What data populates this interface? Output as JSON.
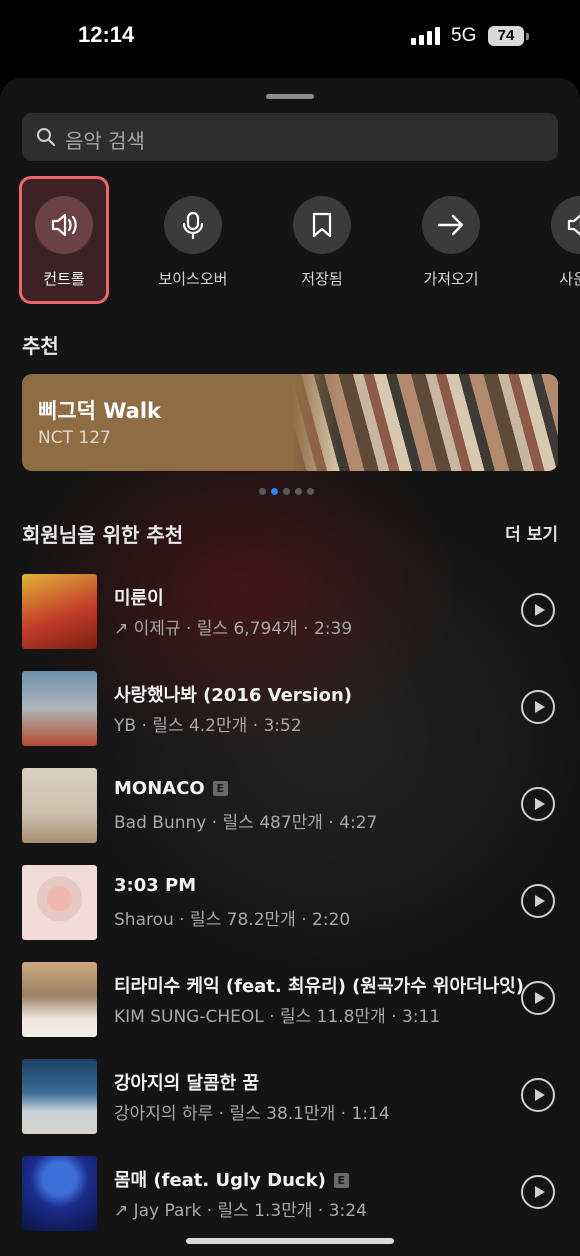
{
  "status": {
    "time": "12:14",
    "network": "5G",
    "battery": "74"
  },
  "search": {
    "placeholder": "음악 검색"
  },
  "actions": [
    {
      "label": "컨트롤",
      "icon": "speaker-icon",
      "active": true
    },
    {
      "label": "보이스오버",
      "icon": "microphone-icon"
    },
    {
      "label": "저장됨",
      "icon": "bookmark-icon"
    },
    {
      "label": "가져오기",
      "icon": "arrow-right-icon"
    },
    {
      "label": "사운드",
      "icon": "speaker-icon"
    }
  ],
  "recommended": {
    "title": "추천",
    "banner": {
      "song": "삐그덕 Walk",
      "artist": "NCT 127"
    },
    "pages": 5,
    "current_page": 2
  },
  "for_you": {
    "title": "회원님을 위한 추천",
    "more": "더 보기",
    "tracks": [
      {
        "title": "미룬이",
        "sub": "↗ 이제규 · 릴스 6,794개 · 2:39",
        "explicit": false
      },
      {
        "title": "사랑했나봐 (2016 Version)",
        "sub": "YB · 릴스 4.2만개 · 3:52",
        "explicit": false
      },
      {
        "title": "MONACO",
        "sub": "Bad Bunny · 릴스 487만개 · 4:27",
        "explicit": true
      },
      {
        "title": "3:03 PM",
        "sub": "Sharou · 릴스 78.2만개 · 2:20",
        "explicit": false
      },
      {
        "title": "티라미수 케익 (feat. 최유리) (원곡가수 위아더나잇)",
        "sub": "KIM SUNG-CHEOL · 릴스 11.8만개 · 3:11",
        "explicit": false
      },
      {
        "title": "강아지의 달콤한 꿈",
        "sub": "강아지의 하루 · 릴스 38.1만개 · 1:14",
        "explicit": false
      },
      {
        "title": "몸매 (feat. Ugly Duck)",
        "sub": "↗ Jay Park · 릴스 1.3만개 · 3:24",
        "explicit": true
      }
    ],
    "explicit_badge": "E"
  }
}
